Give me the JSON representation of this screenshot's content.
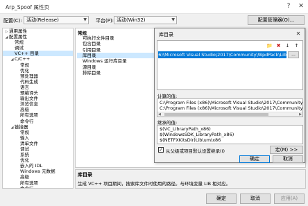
{
  "window": {
    "title": "Arp_Spoof 属性页",
    "help_glyph": "?",
    "close_glyph": "✕"
  },
  "config_bar": {
    "config_label": "配置(C):",
    "config_value": "活动(Release)",
    "platform_label": "平台(P):",
    "platform_value": "活动(Win32)",
    "config_manager_label": "配置管理器(O)..."
  },
  "tree": {
    "rows": [
      {
        "label": "通用属性",
        "toggle": "▷",
        "indent": 0,
        "selected": false
      },
      {
        "label": "配置属性",
        "toggle": "◢",
        "indent": 0,
        "selected": false
      },
      {
        "label": "常规",
        "toggle": "",
        "indent": 1,
        "selected": false
      },
      {
        "label": "调试",
        "toggle": "",
        "indent": 1,
        "selected": false
      },
      {
        "label": "VC++ 目录",
        "toggle": "",
        "indent": 1,
        "selected": true
      },
      {
        "label": "C/C++",
        "toggle": "◢",
        "indent": 1,
        "selected": false
      },
      {
        "label": "常规",
        "toggle": "",
        "indent": 2,
        "selected": false
      },
      {
        "label": "优化",
        "toggle": "",
        "indent": 2,
        "selected": false
      },
      {
        "label": "预处理器",
        "toggle": "",
        "indent": 2,
        "selected": false
      },
      {
        "label": "代码生成",
        "toggle": "",
        "indent": 2,
        "selected": false
      },
      {
        "label": "语言",
        "toggle": "",
        "indent": 2,
        "selected": false
      },
      {
        "label": "预编译头",
        "toggle": "",
        "indent": 2,
        "selected": false
      },
      {
        "label": "输出文件",
        "toggle": "",
        "indent": 2,
        "selected": false
      },
      {
        "label": "浏览信息",
        "toggle": "",
        "indent": 2,
        "selected": false
      },
      {
        "label": "高级",
        "toggle": "",
        "indent": 2,
        "selected": false
      },
      {
        "label": "所有选项",
        "toggle": "",
        "indent": 2,
        "selected": false
      },
      {
        "label": "命令行",
        "toggle": "",
        "indent": 2,
        "selected": false
      },
      {
        "label": "链接器",
        "toggle": "◢",
        "indent": 1,
        "selected": false
      },
      {
        "label": "常规",
        "toggle": "",
        "indent": 2,
        "selected": false
      },
      {
        "label": "输入",
        "toggle": "",
        "indent": 2,
        "selected": false
      },
      {
        "label": "清单文件",
        "toggle": "",
        "indent": 2,
        "selected": false
      },
      {
        "label": "调试",
        "toggle": "",
        "indent": 2,
        "selected": false
      },
      {
        "label": "系统",
        "toggle": "",
        "indent": 2,
        "selected": false
      },
      {
        "label": "优化",
        "toggle": "",
        "indent": 2,
        "selected": false
      },
      {
        "label": "嵌入的 IDL",
        "toggle": "",
        "indent": 2,
        "selected": false
      },
      {
        "label": "Windows 元数据",
        "toggle": "",
        "indent": 2,
        "selected": false
      },
      {
        "label": "高级",
        "toggle": "",
        "indent": 2,
        "selected": false
      },
      {
        "label": "所有选项",
        "toggle": "",
        "indent": 2,
        "selected": false
      },
      {
        "label": "命令行",
        "toggle": "",
        "indent": 2,
        "selected": false
      },
      {
        "label": "清单工具",
        "toggle": "▷",
        "indent": 1,
        "selected": false
      }
    ]
  },
  "props": {
    "group": "常规",
    "rows": [
      {
        "label": "可执行文件目录",
        "selected": false
      },
      {
        "label": "包含目录",
        "selected": false
      },
      {
        "label": "引用目录",
        "selected": false
      },
      {
        "label": "库目录",
        "selected": true
      },
      {
        "label": "Windows 运行库目录",
        "selected": false
      },
      {
        "label": "源目录",
        "selected": false
      },
      {
        "label": "排除目录",
        "selected": false
      }
    ]
  },
  "description": {
    "title": "库目录",
    "text": "生成 VC++ 项目期间，搜索库文件时使用的路径。与环境变量 LIB 相对应。"
  },
  "bottom": {
    "ok": "确定",
    "cancel": "取消",
    "apply": "应用(A)"
  },
  "dialog": {
    "title": "库目录",
    "close_glyph": "✕",
    "toolbar": {
      "new_folder": "📁",
      "delete": "✖",
      "down": "↓",
      "up": "↑"
    },
    "edit_value": "x86)\\Microsoft Visual Studio\\2017\\Community\\WpdPack\\Lib",
    "ellipsis": "...",
    "evaluated_label": "计算的值:",
    "evaluated_lines": [
      "C:\\Program Files (x86)\\Microsoft Visual Studio\\2017\\Community\\W",
      "C:\\Program Files (x86)\\Microsoft Visual Studio\\2017\\Community\\W"
    ],
    "inherited_label": "继承的值:",
    "inherited_lines": [
      "$(VC_LibraryPath_x86)",
      "$(WindowsSDK_LibraryPath_x86)",
      "$(NETFXKitsDir)Lib\\um\\x86"
    ],
    "inherit_checkbox_checked": true,
    "inherit_checkbox_label": "从父级或项目默认设置继承(I)",
    "macros_button": "宏(M) >>",
    "ok": "确定",
    "cancel": "取消"
  }
}
